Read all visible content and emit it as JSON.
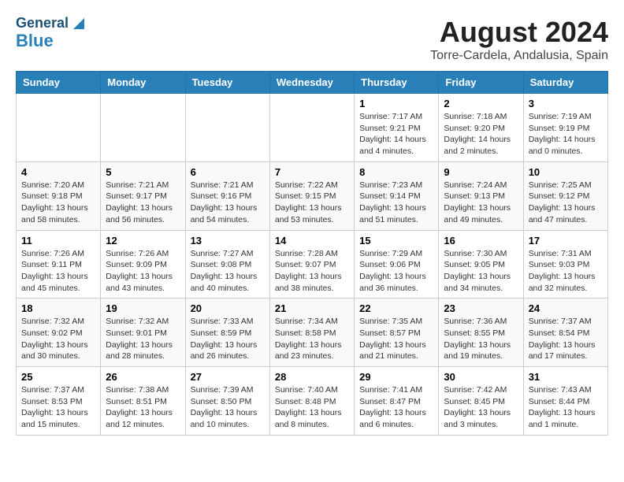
{
  "header": {
    "logo_general": "General",
    "logo_blue": "Blue",
    "main_title": "August 2024",
    "subtitle": "Torre-Cardela, Andalusia, Spain"
  },
  "days_of_week": [
    "Sunday",
    "Monday",
    "Tuesday",
    "Wednesday",
    "Thursday",
    "Friday",
    "Saturday"
  ],
  "weeks": [
    [
      {
        "day": "",
        "info": ""
      },
      {
        "day": "",
        "info": ""
      },
      {
        "day": "",
        "info": ""
      },
      {
        "day": "",
        "info": ""
      },
      {
        "day": "1",
        "info": "Sunrise: 7:17 AM\nSunset: 9:21 PM\nDaylight: 14 hours\nand 4 minutes."
      },
      {
        "day": "2",
        "info": "Sunrise: 7:18 AM\nSunset: 9:20 PM\nDaylight: 14 hours\nand 2 minutes."
      },
      {
        "day": "3",
        "info": "Sunrise: 7:19 AM\nSunset: 9:19 PM\nDaylight: 14 hours\nand 0 minutes."
      }
    ],
    [
      {
        "day": "4",
        "info": "Sunrise: 7:20 AM\nSunset: 9:18 PM\nDaylight: 13 hours\nand 58 minutes."
      },
      {
        "day": "5",
        "info": "Sunrise: 7:21 AM\nSunset: 9:17 PM\nDaylight: 13 hours\nand 56 minutes."
      },
      {
        "day": "6",
        "info": "Sunrise: 7:21 AM\nSunset: 9:16 PM\nDaylight: 13 hours\nand 54 minutes."
      },
      {
        "day": "7",
        "info": "Sunrise: 7:22 AM\nSunset: 9:15 PM\nDaylight: 13 hours\nand 53 minutes."
      },
      {
        "day": "8",
        "info": "Sunrise: 7:23 AM\nSunset: 9:14 PM\nDaylight: 13 hours\nand 51 minutes."
      },
      {
        "day": "9",
        "info": "Sunrise: 7:24 AM\nSunset: 9:13 PM\nDaylight: 13 hours\nand 49 minutes."
      },
      {
        "day": "10",
        "info": "Sunrise: 7:25 AM\nSunset: 9:12 PM\nDaylight: 13 hours\nand 47 minutes."
      }
    ],
    [
      {
        "day": "11",
        "info": "Sunrise: 7:26 AM\nSunset: 9:11 PM\nDaylight: 13 hours\nand 45 minutes."
      },
      {
        "day": "12",
        "info": "Sunrise: 7:26 AM\nSunset: 9:09 PM\nDaylight: 13 hours\nand 43 minutes."
      },
      {
        "day": "13",
        "info": "Sunrise: 7:27 AM\nSunset: 9:08 PM\nDaylight: 13 hours\nand 40 minutes."
      },
      {
        "day": "14",
        "info": "Sunrise: 7:28 AM\nSunset: 9:07 PM\nDaylight: 13 hours\nand 38 minutes."
      },
      {
        "day": "15",
        "info": "Sunrise: 7:29 AM\nSunset: 9:06 PM\nDaylight: 13 hours\nand 36 minutes."
      },
      {
        "day": "16",
        "info": "Sunrise: 7:30 AM\nSunset: 9:05 PM\nDaylight: 13 hours\nand 34 minutes."
      },
      {
        "day": "17",
        "info": "Sunrise: 7:31 AM\nSunset: 9:03 PM\nDaylight: 13 hours\nand 32 minutes."
      }
    ],
    [
      {
        "day": "18",
        "info": "Sunrise: 7:32 AM\nSunset: 9:02 PM\nDaylight: 13 hours\nand 30 minutes."
      },
      {
        "day": "19",
        "info": "Sunrise: 7:32 AM\nSunset: 9:01 PM\nDaylight: 13 hours\nand 28 minutes."
      },
      {
        "day": "20",
        "info": "Sunrise: 7:33 AM\nSunset: 8:59 PM\nDaylight: 13 hours\nand 26 minutes."
      },
      {
        "day": "21",
        "info": "Sunrise: 7:34 AM\nSunset: 8:58 PM\nDaylight: 13 hours\nand 23 minutes."
      },
      {
        "day": "22",
        "info": "Sunrise: 7:35 AM\nSunset: 8:57 PM\nDaylight: 13 hours\nand 21 minutes."
      },
      {
        "day": "23",
        "info": "Sunrise: 7:36 AM\nSunset: 8:55 PM\nDaylight: 13 hours\nand 19 minutes."
      },
      {
        "day": "24",
        "info": "Sunrise: 7:37 AM\nSunset: 8:54 PM\nDaylight: 13 hours\nand 17 minutes."
      }
    ],
    [
      {
        "day": "25",
        "info": "Sunrise: 7:37 AM\nSunset: 8:53 PM\nDaylight: 13 hours\nand 15 minutes."
      },
      {
        "day": "26",
        "info": "Sunrise: 7:38 AM\nSunset: 8:51 PM\nDaylight: 13 hours\nand 12 minutes."
      },
      {
        "day": "27",
        "info": "Sunrise: 7:39 AM\nSunset: 8:50 PM\nDaylight: 13 hours\nand 10 minutes."
      },
      {
        "day": "28",
        "info": "Sunrise: 7:40 AM\nSunset: 8:48 PM\nDaylight: 13 hours\nand 8 minutes."
      },
      {
        "day": "29",
        "info": "Sunrise: 7:41 AM\nSunset: 8:47 PM\nDaylight: 13 hours\nand 6 minutes."
      },
      {
        "day": "30",
        "info": "Sunrise: 7:42 AM\nSunset: 8:45 PM\nDaylight: 13 hours\nand 3 minutes."
      },
      {
        "day": "31",
        "info": "Sunrise: 7:43 AM\nSunset: 8:44 PM\nDaylight: 13 hours\nand 1 minute."
      }
    ]
  ]
}
